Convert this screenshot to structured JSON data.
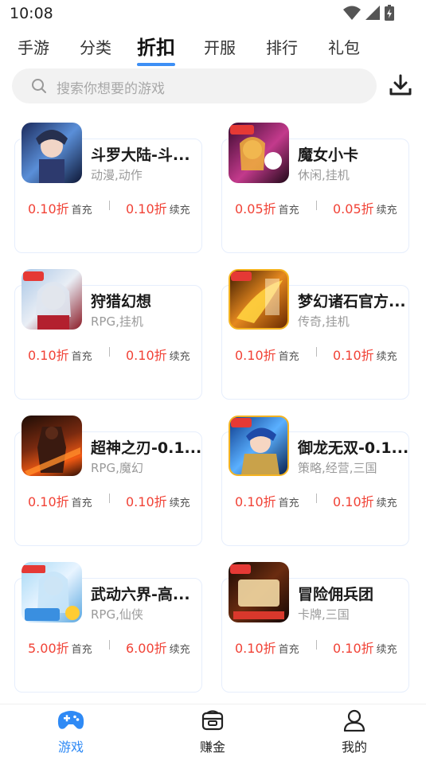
{
  "status_bar": {
    "time": "10:08"
  },
  "tabs": [
    {
      "label": "手游",
      "active": false
    },
    {
      "label": "分类",
      "active": false
    },
    {
      "label": "折扣",
      "active": true
    },
    {
      "label": "开服",
      "active": false
    },
    {
      "label": "排行",
      "active": false
    },
    {
      "label": "礼包",
      "active": false
    }
  ],
  "search": {
    "placeholder": "搜索你想要的游戏"
  },
  "games": [
    {
      "name": "斗罗大陆-斗...",
      "tags": "动漫,动作",
      "first_price": "0.10折",
      "first_label": "首充",
      "renew_price": "0.10折",
      "renew_label": "续充"
    },
    {
      "name": "魔女小卡",
      "tags": "休闲,挂机",
      "first_price": "0.05折",
      "first_label": "首充",
      "renew_price": "0.05折",
      "renew_label": "续充"
    },
    {
      "name": "狩猎幻想",
      "tags": "RPG,挂机",
      "first_price": "0.10折",
      "first_label": "首充",
      "renew_price": "0.10折",
      "renew_label": "续充"
    },
    {
      "name": "梦幻诸石官方...",
      "tags": "传奇,挂机",
      "first_price": "0.10折",
      "first_label": "首充",
      "renew_price": "0.10折",
      "renew_label": "续充"
    },
    {
      "name": "超神之刃-0.1...",
      "tags": "RPG,魔幻",
      "first_price": "0.10折",
      "first_label": "首充",
      "renew_price": "0.10折",
      "renew_label": "续充"
    },
    {
      "name": "御龙无双-0.1...",
      "tags": "策略,经营,三国",
      "first_price": "0.10折",
      "first_label": "首充",
      "renew_price": "0.10折",
      "renew_label": "续充"
    },
    {
      "name": "武动六界-高...",
      "tags": "RPG,仙侠",
      "first_price": "5.00折",
      "first_label": "首充",
      "renew_price": "6.00折",
      "renew_label": "续充"
    },
    {
      "name": "冒险佣兵团",
      "tags": "卡牌,三国",
      "first_price": "0.10折",
      "first_label": "首充",
      "renew_price": "0.10折",
      "renew_label": "续充"
    }
  ],
  "bottom_nav": [
    {
      "label": "游戏",
      "active": true
    },
    {
      "label": "赚金",
      "active": false
    },
    {
      "label": "我的",
      "active": false
    }
  ],
  "colors": {
    "accent": "#2f8af5",
    "price": "#f14236",
    "card_border": "#e6eefc"
  }
}
